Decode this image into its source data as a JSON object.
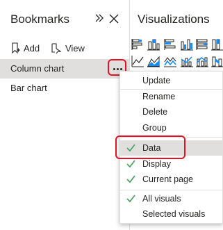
{
  "bookmarks": {
    "title": "Bookmarks",
    "add_label": "Add",
    "view_label": "View",
    "items": [
      {
        "label": "Column chart"
      },
      {
        "label": "Bar chart"
      }
    ]
  },
  "visualizations": {
    "title": "Visualizations"
  },
  "context_menu": {
    "items": [
      {
        "label": "Update"
      },
      {
        "label": "Rename"
      },
      {
        "label": "Delete"
      },
      {
        "label": "Group"
      },
      {
        "label": "Data",
        "checked": true
      },
      {
        "label": "Display",
        "checked": true
      },
      {
        "label": "Current page",
        "checked": true
      },
      {
        "label": "All visuals",
        "checked": true
      },
      {
        "label": "Selected visuals",
        "checked": false
      }
    ]
  },
  "colors": {
    "highlight_border": "#e81123",
    "check": "#4aa564",
    "selected_row": "#e1dfdd"
  }
}
